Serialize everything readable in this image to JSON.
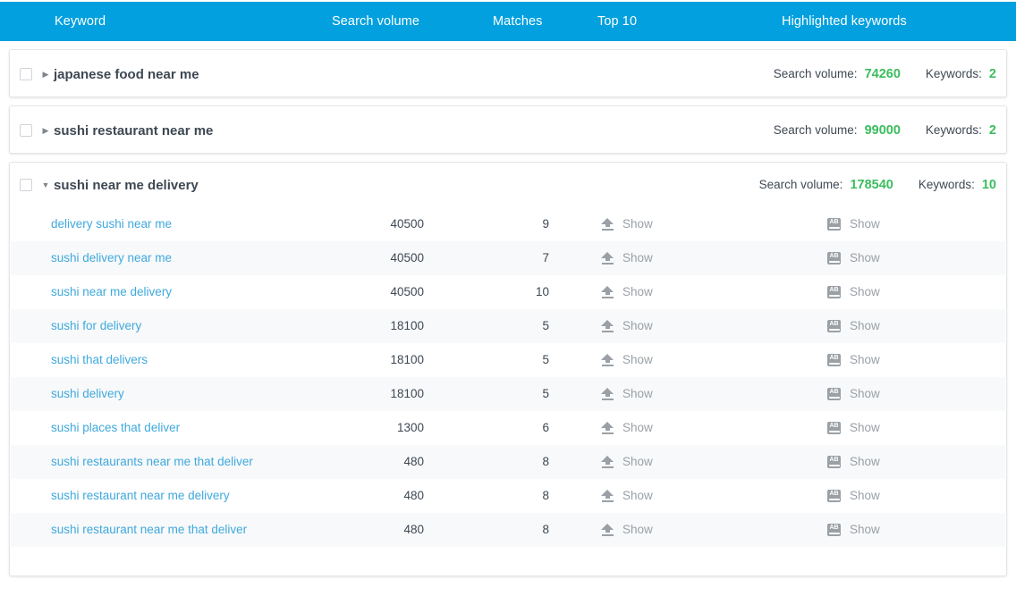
{
  "table": {
    "columns": [
      {
        "key": "keyword",
        "label": "Keyword"
      },
      {
        "key": "volume",
        "label": "Search volume"
      },
      {
        "key": "matches",
        "label": "Matches"
      },
      {
        "key": "top10",
        "label": "Top 10"
      },
      {
        "key": "highlighted",
        "label": "Highlighted keywords"
      }
    ],
    "accent_color": "#02a0de",
    "value_color": "#3bbd5e",
    "link_color": "#3fa9dd"
  },
  "labels": {
    "search_volume": "Search volume:",
    "keywords": "Keywords:",
    "show": "Show",
    "caret_collapsed": "▶",
    "caret_expanded": "▼",
    "ab_icon_text": "AB"
  },
  "groups": [
    {
      "title": "japanese food near me",
      "expanded": false,
      "checked": false,
      "search_volume": "74260",
      "keyword_count": "2",
      "rows": []
    },
    {
      "title": "sushi restaurant near me",
      "expanded": false,
      "checked": false,
      "search_volume": "99000",
      "keyword_count": "2",
      "rows": []
    },
    {
      "title": "sushi near me delivery",
      "expanded": true,
      "checked": false,
      "search_volume": "178540",
      "keyword_count": "10",
      "rows": [
        {
          "keyword": "delivery sushi near me",
          "volume": "40500",
          "matches": "9",
          "top10": "Show",
          "highlighted": "Show"
        },
        {
          "keyword": "sushi delivery near me",
          "volume": "40500",
          "matches": "7",
          "top10": "Show",
          "highlighted": "Show"
        },
        {
          "keyword": "sushi near me delivery",
          "volume": "40500",
          "matches": "10",
          "top10": "Show",
          "highlighted": "Show"
        },
        {
          "keyword": "sushi for delivery",
          "volume": "18100",
          "matches": "5",
          "top10": "Show",
          "highlighted": "Show"
        },
        {
          "keyword": "sushi that delivers",
          "volume": "18100",
          "matches": "5",
          "top10": "Show",
          "highlighted": "Show"
        },
        {
          "keyword": "sushi delivery",
          "volume": "18100",
          "matches": "5",
          "top10": "Show",
          "highlighted": "Show"
        },
        {
          "keyword": "sushi places that deliver",
          "volume": "1300",
          "matches": "6",
          "top10": "Show",
          "highlighted": "Show"
        },
        {
          "keyword": "sushi restaurants near me that deliver",
          "volume": "480",
          "matches": "8",
          "top10": "Show",
          "highlighted": "Show"
        },
        {
          "keyword": "sushi restaurant near me delivery",
          "volume": "480",
          "matches": "8",
          "top10": "Show",
          "highlighted": "Show"
        },
        {
          "keyword": "sushi restaurant near me that deliver",
          "volume": "480",
          "matches": "8",
          "top10": "Show",
          "highlighted": "Show"
        }
      ]
    }
  ]
}
